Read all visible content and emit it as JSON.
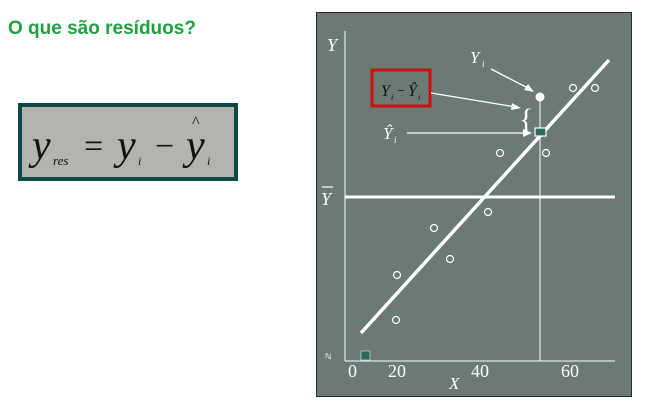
{
  "slide": {
    "title": "O que são resíduos?"
  },
  "formula": {
    "lhs_var": "y",
    "lhs_sub": "res",
    "equals": "=",
    "term1_var": "y",
    "term1_sub": "i",
    "minus": "−",
    "hat": "^",
    "term2_var": "y",
    "term2_sub": "i"
  },
  "figure": {
    "y_axis_label": "Y",
    "x_axis_label": "X",
    "ybar_label": "Y",
    "callout_yi": "Y",
    "callout_yi_sub": "i",
    "callout_residual": "Y",
    "callout_residual_sub": "i",
    "callout_residual_minus": "−",
    "callout_residual_hat": "Ŷ",
    "callout_residual_hat_sub": "i",
    "callout_yhat": "Ŷ",
    "callout_yhat_sub": "i",
    "small_corner_glyph": "ℕ",
    "x_tick_labels": [
      "0",
      "20",
      "40",
      "60"
    ],
    "colors": {
      "panel_bg": "#6b7a72",
      "line": "#ffffff",
      "highlight_box": "#d01010",
      "marker": "#2e6b5a"
    }
  }
}
